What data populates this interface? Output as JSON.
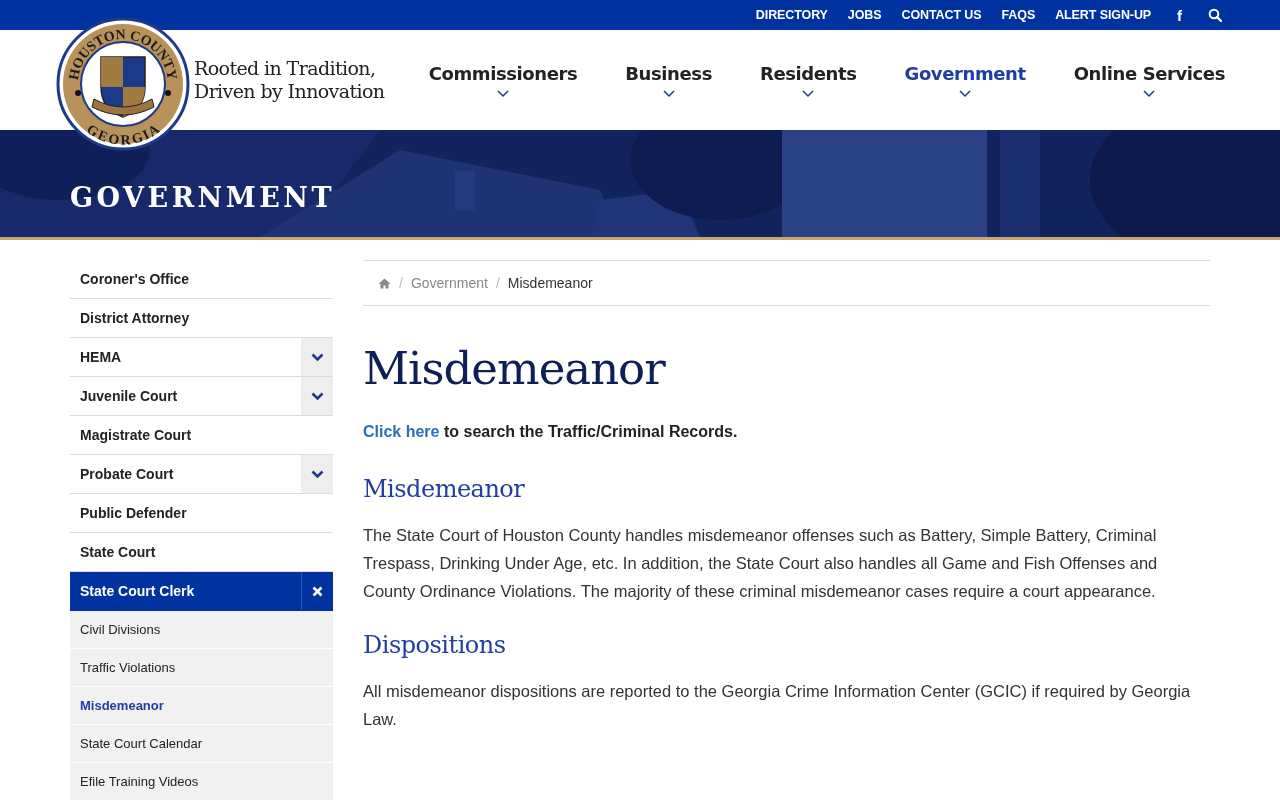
{
  "top_bar": {
    "links": [
      "DIRECTORY",
      "JOBS",
      "CONTACT US",
      "FAQS",
      "ALERT SIGN-UP"
    ],
    "facebook": "f"
  },
  "header": {
    "seal_top": "HOUSTON COUNTY",
    "seal_bottom": "GEORGIA",
    "tagline": [
      "Rooted in Tradition,",
      "Driven by Innovation"
    ],
    "nav": [
      {
        "label": "Commissioners",
        "selected": false
      },
      {
        "label": "Business",
        "selected": false
      },
      {
        "label": "Residents",
        "selected": false
      },
      {
        "label": "Government",
        "selected": true
      },
      {
        "label": "Online Services",
        "selected": false
      }
    ]
  },
  "banner": {
    "title": "GOVERNMENT",
    "kind": "picture"
  },
  "sidebar": {
    "items": [
      {
        "label": "Coroner's Office",
        "selected": false
      },
      {
        "label": "District Attorney",
        "selected": false
      },
      {
        "label": "HEMA",
        "selected": false,
        "expanded": false
      },
      {
        "label": "Juvenile Court",
        "selected": false,
        "expanded": false
      },
      {
        "label": "Magistrate Court",
        "selected": false
      },
      {
        "label": "Probate Court",
        "selected": false,
        "expanded": false
      },
      {
        "label": "Public Defender",
        "selected": false
      },
      {
        "label": "State Court",
        "selected": false
      },
      {
        "label": "State Court Clerk",
        "selected": true,
        "expanded": true,
        "children": [
          {
            "label": "Civil Divisions",
            "selected": false
          },
          {
            "label": "Traffic Violations",
            "selected": false
          },
          {
            "label": "Misdemeanor",
            "selected": true
          },
          {
            "label": "State Court Calendar",
            "selected": false
          },
          {
            "label": "Efile Training Videos",
            "selected": false
          }
        ]
      }
    ]
  },
  "breadcrumb": {
    "separator": "/",
    "items": [
      "Government",
      "Misdemeanor"
    ]
  },
  "content": {
    "title": "Misdemeanor",
    "intro_link": "Click here",
    "intro_rest": "to search the Traffic/Criminal Records.",
    "sections": [
      {
        "heading": "Misdemeanor",
        "text": "The State Court of Houston County handles misdemeanor offenses such as Battery, Simple Battery, Criminal Trespass, Drinking Under Age, etc. In addition, the State Court also handles all Game and Fish Offenses and County Ordinance Violations. The majority of these criminal misdemeanor cases require a court appearance."
      },
      {
        "heading": "Dispositions",
        "text": "All misdemeanor dispositions are reported to the Georgia Crime Information Center (GCIC) if required by Georgia Law."
      }
    ]
  }
}
